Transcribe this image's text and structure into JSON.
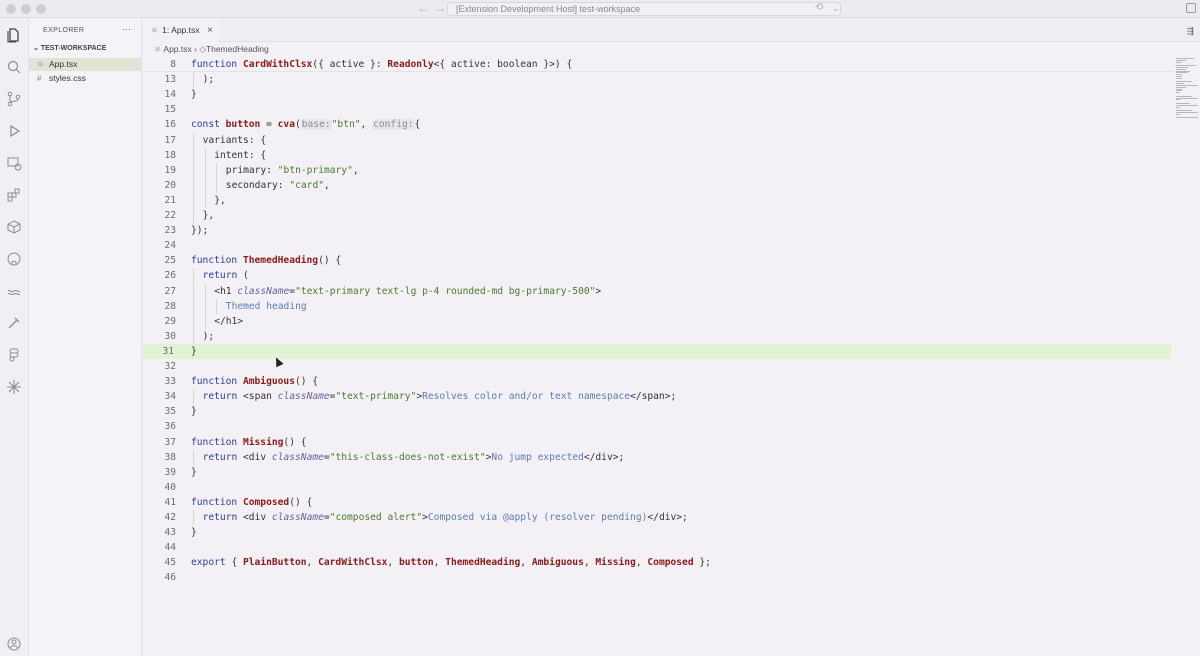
{
  "window": {
    "title": "[Extension Development Host] test-workspace"
  },
  "explorer": {
    "header": "EXPLORER",
    "more": "···",
    "workspace": "TEST-WORKSPACE",
    "files": [
      {
        "name": "App.tsx",
        "icon": "⚛",
        "selected": true
      },
      {
        "name": "styles.css",
        "icon": "#",
        "selected": false
      }
    ]
  },
  "tabs": [
    {
      "label": "1: App.tsx",
      "icon": "⚛",
      "close": "×"
    }
  ],
  "breadcrumb": {
    "file": "App.tsx",
    "separator": "›",
    "symbol": "ThemedHeading"
  },
  "editor": {
    "highlighted_line": "31",
    "lines": [
      {
        "n": "8",
        "sticky": true
      },
      {
        "n": "13"
      },
      {
        "n": "14"
      },
      {
        "n": "15"
      },
      {
        "n": "16"
      },
      {
        "n": "17"
      },
      {
        "n": "18"
      },
      {
        "n": "19"
      },
      {
        "n": "20"
      },
      {
        "n": "21"
      },
      {
        "n": "22"
      },
      {
        "n": "23"
      },
      {
        "n": "24"
      },
      {
        "n": "25"
      },
      {
        "n": "26"
      },
      {
        "n": "27"
      },
      {
        "n": "28"
      },
      {
        "n": "29"
      },
      {
        "n": "30"
      },
      {
        "n": "31"
      },
      {
        "n": "32"
      },
      {
        "n": "33"
      },
      {
        "n": "34"
      },
      {
        "n": "35"
      },
      {
        "n": "36"
      },
      {
        "n": "37"
      },
      {
        "n": "38"
      },
      {
        "n": "39"
      },
      {
        "n": "40"
      },
      {
        "n": "41"
      },
      {
        "n": "42"
      },
      {
        "n": "43"
      },
      {
        "n": "44"
      },
      {
        "n": "45"
      },
      {
        "n": "46"
      }
    ],
    "code": {
      "l8": {
        "kw": "function ",
        "fn": "CardWithClsx",
        "a": "({ active }: ",
        "b": "Readonly",
        "c": "<{ active: boolean }>) {"
      },
      "l13": {
        "a": ");"
      },
      "l14": {
        "a": "}"
      },
      "l16": {
        "kw": "const ",
        "name": "button",
        "eq": " = ",
        "fn": "cva",
        "p": "(",
        "h1": "base:",
        "s1": "\"btn\"",
        "c": ", ",
        "h2": "config:",
        "e": "{"
      },
      "l17": {
        "a": "variants: {"
      },
      "l18": {
        "a": "intent: {"
      },
      "l19": {
        "a": "primary: ",
        "s": "\"btn-primary\"",
        "e": ","
      },
      "l20": {
        "a": "secondary: ",
        "s": "\"card\"",
        "e": ","
      },
      "l21": {
        "a": "},"
      },
      "l22": {
        "a": "},"
      },
      "l23": {
        "a": "});"
      },
      "l25": {
        "kw": "function ",
        "fn": "ThemedHeading",
        "a": "() {"
      },
      "l26": {
        "kw": "return",
        "a": " ("
      },
      "l27": {
        "t": "<h1 ",
        "at": "className",
        "eq": "=",
        "s": "\"text-primary text-lg p-4 rounded-md bg-primary-500\"",
        "e": ">"
      },
      "l28": {
        "txt": "Themed heading"
      },
      "l29": {
        "t": "</h1>"
      },
      "l30": {
        "a": ");"
      },
      "l31": {
        "a": "}"
      },
      "l33": {
        "kw": "function ",
        "fn": "Ambiguous",
        "a": "() {"
      },
      "l34": {
        "kw": "return ",
        "t": "<span ",
        "at": "className",
        "eq": "=",
        "s": "\"text-primary\"",
        "e": ">",
        "txt": "Resolves color and/or text namespace",
        "close": "</span>;"
      },
      "l35": {
        "a": "}"
      },
      "l37": {
        "kw": "function ",
        "fn": "Missing",
        "a": "() {"
      },
      "l38": {
        "kw": "return ",
        "t": "<div ",
        "at": "className",
        "eq": "=",
        "s": "\"this-class-does-not-exist\"",
        "e": ">",
        "txt": "No jump expected",
        "close": "</div>;"
      },
      "l39": {
        "a": "}"
      },
      "l41": {
        "kw": "function ",
        "fn": "Composed",
        "a": "() {"
      },
      "l42": {
        "kw": "return ",
        "t": "<div ",
        "at": "className",
        "eq": "=",
        "s": "\"composed alert\"",
        "e": ">",
        "txt": "Composed via @apply (resolver pending)",
        "close": "</div>;"
      },
      "l43": {
        "a": "}"
      },
      "l45": {
        "kw": "export ",
        "a": "{ ",
        "n1": "PlainButton",
        "c1": ", ",
        "n2": "CardWithClsx",
        "c2": ", ",
        "n3": "button",
        "c3": ", ",
        "n4": "ThemedHeading",
        "c4": ", ",
        "n5": "Ambiguous",
        "c5": ", ",
        "n6": "Missing",
        "c6": ", ",
        "n7": "Composed",
        "e": " };"
      }
    }
  },
  "colors": {
    "highlight": "#e0f3d4",
    "selected_file": "#dfe4d4",
    "keyword": "#2c3e9c",
    "function": "#8b1a1a",
    "string": "#4b7a2c"
  }
}
